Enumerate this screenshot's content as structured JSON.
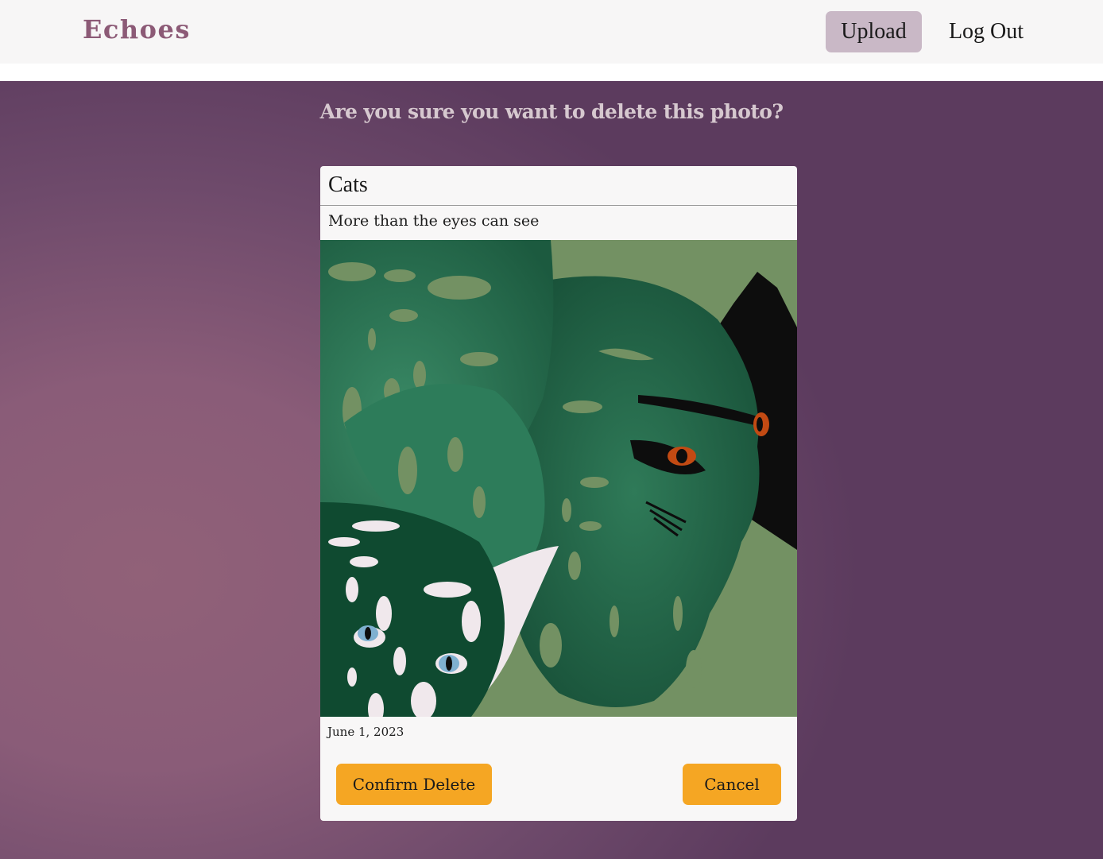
{
  "navbar": {
    "brand": "Echoes",
    "upload_label": "Upload",
    "logout_label": "Log Out"
  },
  "main": {
    "heading": "Are you sure you want to delete this photo?"
  },
  "photo_card": {
    "title": "Cats",
    "description": "More than the eyes can see",
    "image_subject": "monstera-leaves-with-hidden-cats-illustration",
    "date": "June 1, 2023",
    "confirm_label": "Confirm Delete",
    "cancel_label": "Cancel"
  },
  "colors": {
    "brand": "#8c5a76",
    "upload_bg": "#c9b8c6",
    "button_accent": "#f5a623",
    "background_purple": "#6e4a6b"
  }
}
